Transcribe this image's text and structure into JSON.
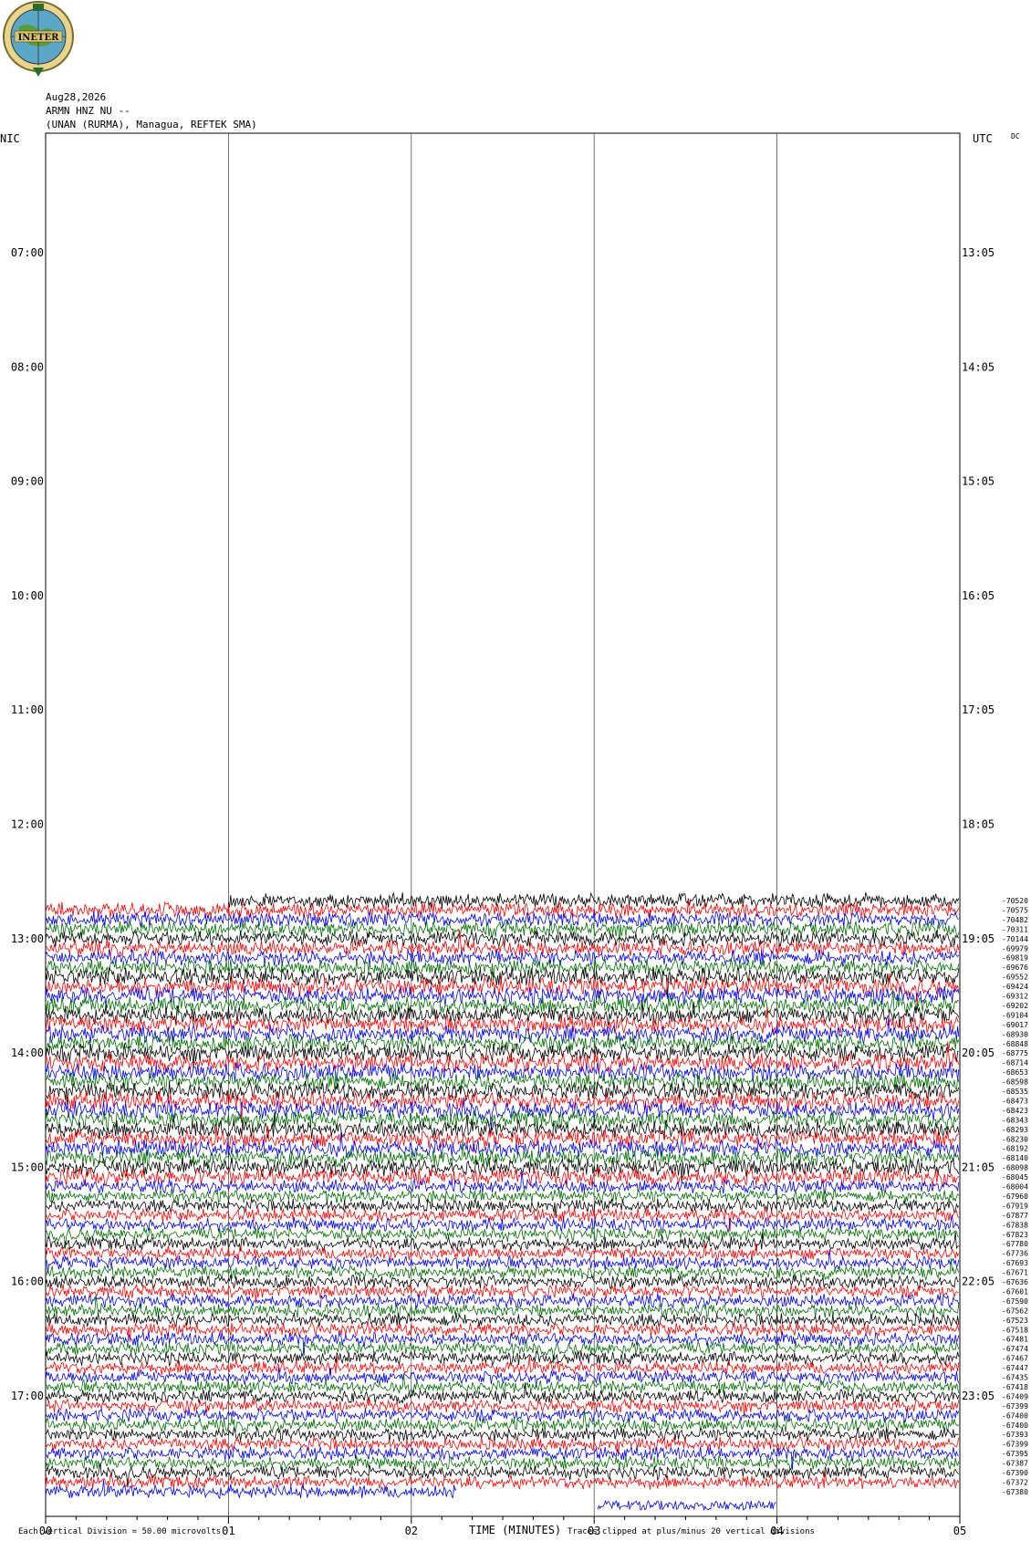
{
  "header": {
    "date": "Aug28,2026",
    "station": "ARMN HNZ NU --",
    "location": "(UNAN (RURMA), Managua, REFTEK SMA)",
    "logo_text": "INETER"
  },
  "chart_data": {
    "type": "line",
    "left_axis_label": "NIC",
    "right_axis_label": "UTC",
    "dc_label": "DC",
    "left_time_labels": [
      "07:00",
      "08:00",
      "09:00",
      "10:00",
      "11:00",
      "12:00",
      "13:00",
      "14:00",
      "15:00",
      "16:00",
      "17:00"
    ],
    "right_time_labels": [
      "13:05",
      "14:05",
      "15:05",
      "16:05",
      "17:05",
      "18:05",
      "19:05",
      "20:05",
      "21:05",
      "22:05",
      "23:05"
    ],
    "x_tick_labels": [
      "00",
      "01",
      "02",
      "03",
      "04",
      "05"
    ],
    "xlabel": "TIME (MINUTES)",
    "xlim": [
      0,
      5
    ],
    "vertical_division": "Each Vertical Division =    50.00 microvolts",
    "clip_note": "Traces clipped at plus/minus 20 vertical divisions",
    "trace_colors": [
      "#000000",
      "#ff0000",
      "#0000ff",
      "#007000"
    ],
    "dc_offsets": [
      "-70520",
      "-70575",
      "-70482",
      "-70311",
      "-70144",
      "-69979",
      "-69819",
      "-69676",
      "-69552",
      "-69424",
      "-69312",
      "-69202",
      "-69104",
      "-69017",
      "-68930",
      "-68848",
      "-68775",
      "-68714",
      "-68653",
      "-68598",
      "-68535",
      "-68473",
      "-68423",
      "-68343",
      "-68293",
      "-68230",
      "-68192",
      "-68140",
      "-68098",
      "-68045",
      "-68004",
      "-67960",
      "-67919",
      "-67877",
      "-67838",
      "-67823",
      "-67780",
      "-67736",
      "-67693",
      "-67671",
      "-67636",
      "-67601",
      "-67590",
      "-67562",
      "-67523",
      "-67518",
      "-67481",
      "-67474",
      "-67467",
      "-67447",
      "-67435",
      "-67418",
      "-67409",
      "-67399",
      "-67400",
      "-67400",
      "-67393",
      "-67399",
      "-67395",
      "-67387",
      "-67390",
      "-67372",
      "-67380"
    ]
  }
}
